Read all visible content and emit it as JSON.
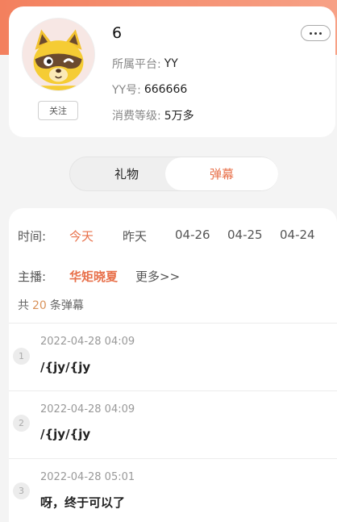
{
  "profile": {
    "name": "6",
    "follow_label": "关注",
    "platform_label": "所属平台:",
    "platform_value": "YY",
    "yy_label": "YY号:",
    "yy_value": "666666",
    "level_label": "消费等级:",
    "level_value": "5万多",
    "avatar_icon": "raccoon-avatar-icon",
    "more_icon": "more-dots-icon"
  },
  "tabs": [
    {
      "label": "礼物",
      "active": false
    },
    {
      "label": "弹幕",
      "active": true
    }
  ],
  "filters": {
    "time_label": "时间:",
    "time_options": [
      {
        "label": "今天",
        "active": true
      },
      {
        "label": "昨天",
        "active": false
      },
      {
        "label": "04-26",
        "active": false
      },
      {
        "label": "04-25",
        "active": false
      },
      {
        "label": "04-24",
        "active": false
      }
    ],
    "host_label": "主播:",
    "host_selected": "华矩晓夏",
    "host_more": "更多>>"
  },
  "count": {
    "prefix": "共",
    "value": "20",
    "suffix": "条弹幕"
  },
  "messages": [
    {
      "index": "1",
      "time": "2022-04-28 04:09",
      "text": "/{jy/{jy"
    },
    {
      "index": "2",
      "time": "2022-04-28 04:09",
      "text": "/{jy/{jy"
    },
    {
      "index": "3",
      "time": "2022-04-28 05:01",
      "text": "呀，终于可以了"
    }
  ],
  "colors": {
    "accent": "#e8704a",
    "header_gradient_start": "#f3805e",
    "header_gradient_end": "#f7a186",
    "count_number": "#d9925a"
  }
}
